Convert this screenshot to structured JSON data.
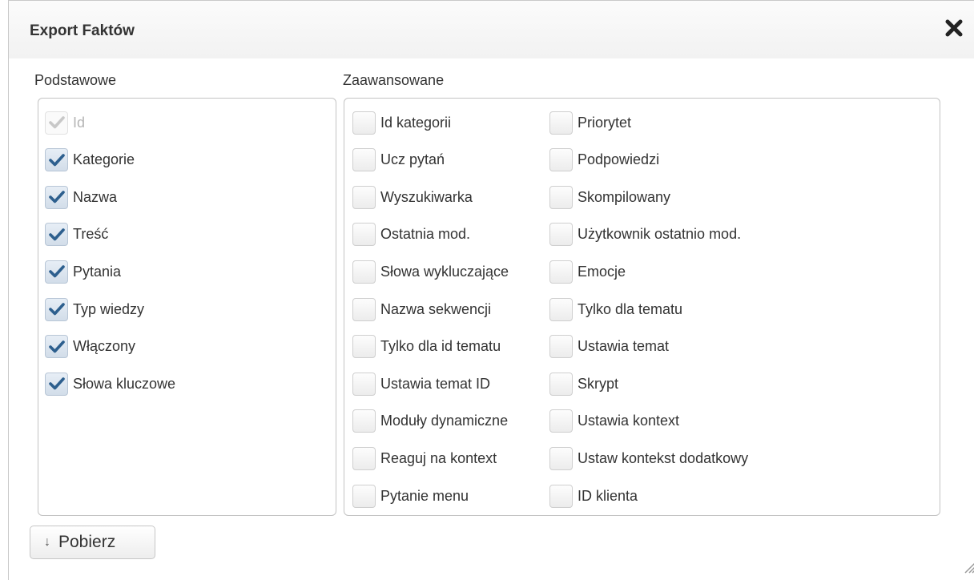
{
  "dialog": {
    "title": "Export Faktów",
    "close_icon": "close-icon"
  },
  "basic": {
    "label": "Podstawowe",
    "items": [
      {
        "label": "Id",
        "checked": true,
        "disabled": true
      },
      {
        "label": "Kategorie",
        "checked": true,
        "disabled": false
      },
      {
        "label": "Nazwa",
        "checked": true,
        "disabled": false
      },
      {
        "label": "Treść",
        "checked": true,
        "disabled": false
      },
      {
        "label": "Pytania",
        "checked": true,
        "disabled": false
      },
      {
        "label": "Typ wiedzy",
        "checked": true,
        "disabled": false
      },
      {
        "label": "Włączony",
        "checked": true,
        "disabled": false
      },
      {
        "label": "Słowa kluczowe",
        "checked": true,
        "disabled": false
      }
    ]
  },
  "advanced": {
    "label": "Zaawansowane",
    "col1": [
      {
        "label": "Id kategorii",
        "checked": false
      },
      {
        "label": "Ucz pytań",
        "checked": false
      },
      {
        "label": "Wyszukiwarka",
        "checked": false
      },
      {
        "label": "Ostatnia mod.",
        "checked": false
      },
      {
        "label": "Słowa wykluczające",
        "checked": false
      },
      {
        "label": "Nazwa sekwencji",
        "checked": false
      },
      {
        "label": "Tylko dla id tematu",
        "checked": false
      },
      {
        "label": "Ustawia temat ID",
        "checked": false
      },
      {
        "label": "Moduły dynamiczne",
        "checked": false
      },
      {
        "label": "Reaguj na kontext",
        "checked": false
      },
      {
        "label": "Pytanie menu",
        "checked": false
      }
    ],
    "col2": [
      {
        "label": "Priorytet",
        "checked": false
      },
      {
        "label": "Podpowiedzi",
        "checked": false
      },
      {
        "label": "Skompilowany",
        "checked": false
      },
      {
        "label": "Użytkownik ostatnio mod.",
        "checked": false
      },
      {
        "label": "Emocje",
        "checked": false
      },
      {
        "label": "Tylko dla tematu",
        "checked": false
      },
      {
        "label": "Ustawia temat",
        "checked": false
      },
      {
        "label": "Skrypt",
        "checked": false
      },
      {
        "label": "Ustawia kontext",
        "checked": false
      },
      {
        "label": "Ustaw kontekst dodatkowy",
        "checked": false
      },
      {
        "label": "ID klienta",
        "checked": false
      }
    ]
  },
  "download_button": {
    "label": "Pobierz",
    "icon": "arrow-down-icon"
  },
  "colors": {
    "check_mark": "#2d5f8e",
    "check_mark_disabled": "#c8c8c8"
  }
}
